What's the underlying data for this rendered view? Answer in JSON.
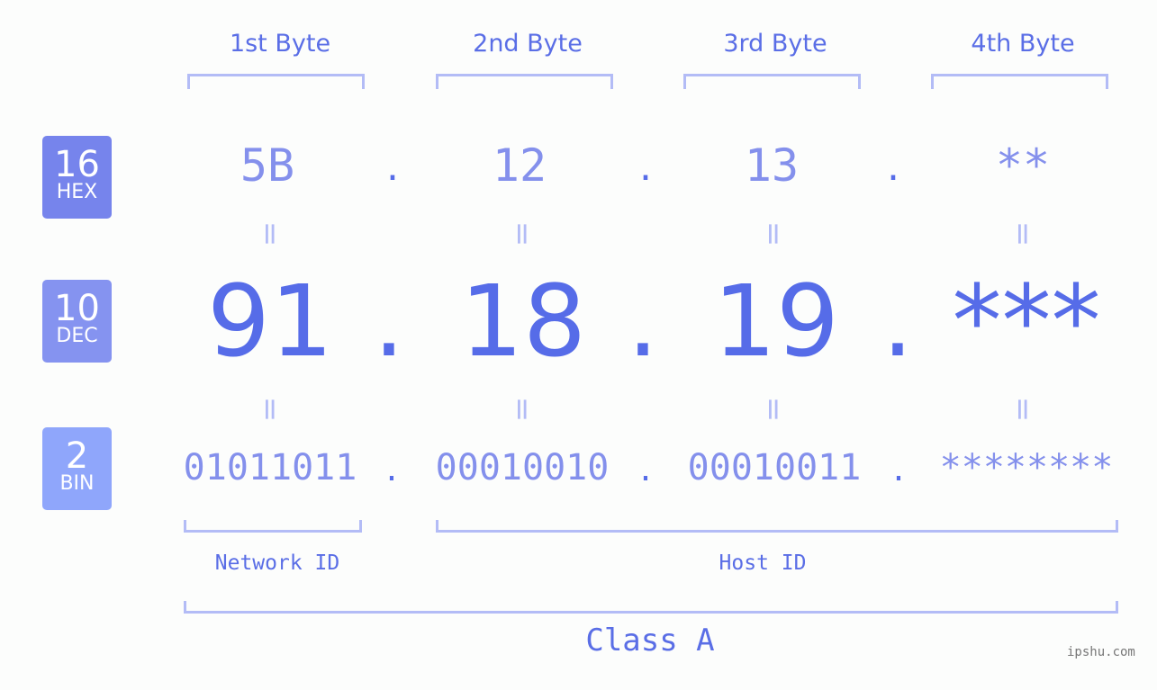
{
  "colors": {
    "accent": "#566ce8",
    "light": "#8490ec",
    "bracket": "#b3bcf6",
    "hex_badge": "#7684ec",
    "dec_badge": "#8593f0",
    "bin_badge": "#8fa6fb"
  },
  "headers": [
    "1st Byte",
    "2nd Byte",
    "3rd Byte",
    "4th Byte"
  ],
  "badges": {
    "hex": {
      "num": "16",
      "label": "HEX"
    },
    "dec": {
      "num": "10",
      "label": "DEC"
    },
    "bin": {
      "num": "2",
      "label": "BIN"
    }
  },
  "hex_values": [
    "5B",
    "12",
    "13",
    "**"
  ],
  "dec_values": [
    "91",
    "18",
    "19",
    "***"
  ],
  "bin_values": [
    "01011011",
    "00010010",
    "00010011",
    "********"
  ],
  "separator": ".",
  "equals": "=",
  "network_id": "Network ID",
  "host_id": "Host ID",
  "class_label": "Class A",
  "watermark": "ipshu.com"
}
